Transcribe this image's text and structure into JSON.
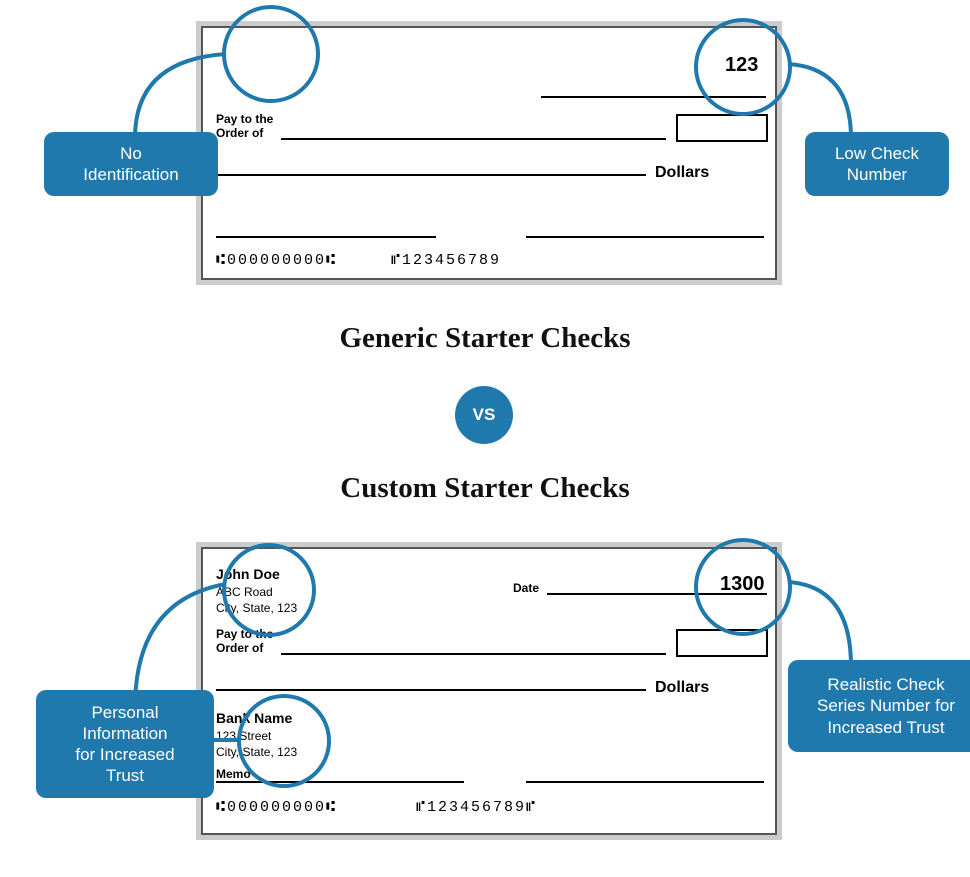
{
  "headings": {
    "generic": "Generic Starter Checks",
    "custom": "Custom Starter Checks",
    "vs": "VS"
  },
  "annotations": {
    "no_identification": "No\nIdentification",
    "low_check_number": "Low Check\nNumber",
    "personal_info": "Personal\nInformation\nfor Increased\nTrust",
    "realistic_number": "Realistic Check\nSeries Number for\nIncreased Trust"
  },
  "generic_check": {
    "check_number": "123",
    "pay_to_line1": "Pay to the",
    "pay_to_line2": "Order    of",
    "dollars": "Dollars",
    "micr1": "⑆000000000⑆",
    "micr2": "⑈123456789"
  },
  "custom_check": {
    "check_number": "1300",
    "name": "John Doe",
    "addr1": "ABC Road",
    "addr2": "City, State, 123",
    "date_label": "Date",
    "pay_to_line1": "Pay to the",
    "pay_to_line2": "Order    of",
    "dollars": "Dollars",
    "bank_name": "Bank Name",
    "bank_addr1": "123 Street",
    "bank_addr2": "City, State, 123",
    "memo_label": "Memo",
    "micr1": "⑆000000000⑆",
    "micr2": "⑈123456789⑈"
  }
}
